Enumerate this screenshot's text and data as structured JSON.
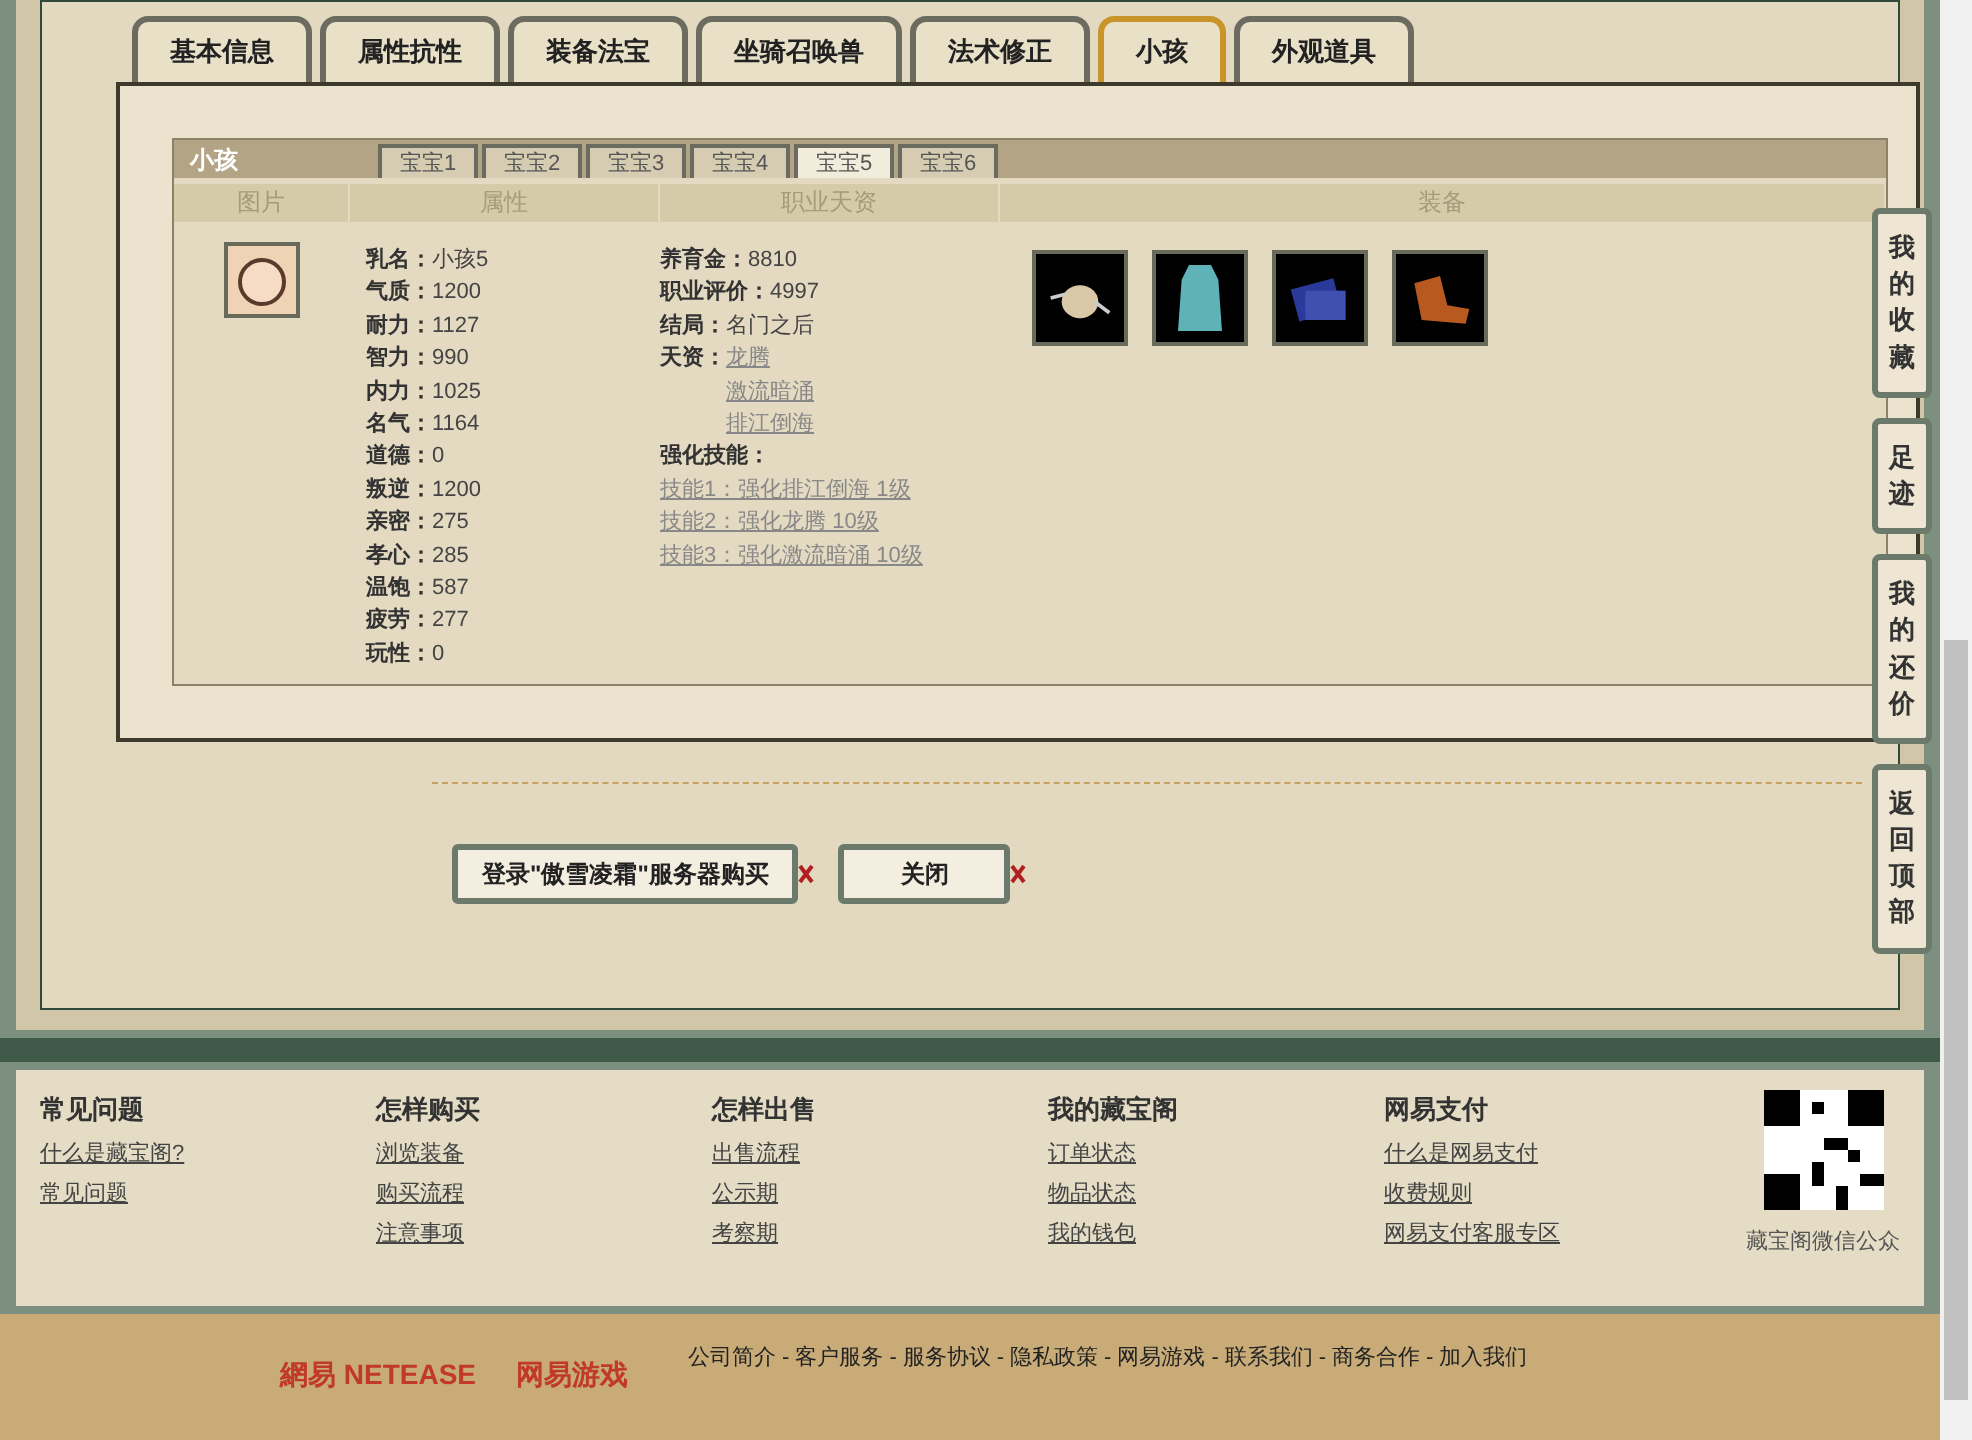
{
  "main_tabs": [
    {
      "label": "基本信息",
      "selected": false
    },
    {
      "label": "属性抗性",
      "selected": false
    },
    {
      "label": "装备法宝",
      "selected": false
    },
    {
      "label": "坐骑召唤兽",
      "selected": false
    },
    {
      "label": "法术修正",
      "selected": false
    },
    {
      "label": "小孩",
      "selected": true
    },
    {
      "label": "外观道具",
      "selected": false
    }
  ],
  "child_panel": {
    "title": "小孩",
    "tabs": [
      {
        "label": "宝宝1",
        "selected": false
      },
      {
        "label": "宝宝2",
        "selected": false
      },
      {
        "label": "宝宝3",
        "selected": false
      },
      {
        "label": "宝宝4",
        "selected": false
      },
      {
        "label": "宝宝5",
        "selected": true
      },
      {
        "label": "宝宝6",
        "selected": false
      }
    ],
    "columns": [
      "图片",
      "属性",
      "职业天资",
      "装备"
    ],
    "attributes": [
      {
        "label": "乳名：",
        "value": "小孩5"
      },
      {
        "label": "气质：",
        "value": "1200"
      },
      {
        "label": "耐力：",
        "value": "1127"
      },
      {
        "label": "智力：",
        "value": "990"
      },
      {
        "label": "内力：",
        "value": "1025"
      },
      {
        "label": "名气：",
        "value": "1164"
      },
      {
        "label": "道德：",
        "value": "0"
      },
      {
        "label": "叛逆：",
        "value": "1200"
      },
      {
        "label": "亲密：",
        "value": "275"
      },
      {
        "label": "孝心：",
        "value": "285"
      },
      {
        "label": "温饱：",
        "value": "587"
      },
      {
        "label": "疲劳：",
        "value": "277"
      },
      {
        "label": "玩性：",
        "value": "0"
      }
    ],
    "career": [
      {
        "label": "养育金：",
        "value": "8810"
      },
      {
        "label": "职业评价：",
        "value": "4997"
      },
      {
        "label": "结局：",
        "value": "名门之后"
      }
    ],
    "talent": {
      "label": "天资：",
      "links": [
        "龙腾",
        "激流暗涌",
        "排江倒海"
      ]
    },
    "skills": {
      "label": "强化技能：",
      "links": [
        "技能1：强化排江倒海 1级",
        "技能2：强化龙腾 10级",
        "技能3：强化激流暗涌 10级"
      ]
    },
    "equipment": [
      {
        "kind": "hat"
      },
      {
        "kind": "robe"
      },
      {
        "kind": "book"
      },
      {
        "kind": "boots"
      }
    ]
  },
  "actions": [
    {
      "label": "登录\"傲雪凌霜\"服务器购买"
    },
    {
      "label": "关闭"
    }
  ],
  "side_nav": [
    "我的收藏",
    "足迹",
    "我的还价",
    "返回顶部"
  ],
  "footer": {
    "columns": [
      {
        "title": "常见问题",
        "links": [
          "什么是藏宝阁?",
          "常见问题"
        ]
      },
      {
        "title": "怎样购买",
        "links": [
          "浏览装备",
          "购买流程",
          "注意事项"
        ]
      },
      {
        "title": "怎样出售",
        "links": [
          "出售流程",
          "公示期",
          "考察期"
        ]
      },
      {
        "title": "我的藏宝阁",
        "links": [
          "订单状态",
          "物品状态",
          "我的钱包"
        ]
      },
      {
        "title": "网易支付",
        "links": [
          "什么是网易支付",
          "收费规则",
          "网易支付客服专区"
        ]
      }
    ],
    "qr_caption": "藏宝阁微信公众"
  },
  "bottom_bar": {
    "logos": [
      "網易 NETEASE",
      "网易游戏"
    ],
    "separator": "-",
    "links": [
      "公司简介",
      "客户服务",
      "服务协议",
      "隐私政策",
      "网易游戏",
      "联系我们",
      "商务合作",
      "加入我们"
    ]
  }
}
